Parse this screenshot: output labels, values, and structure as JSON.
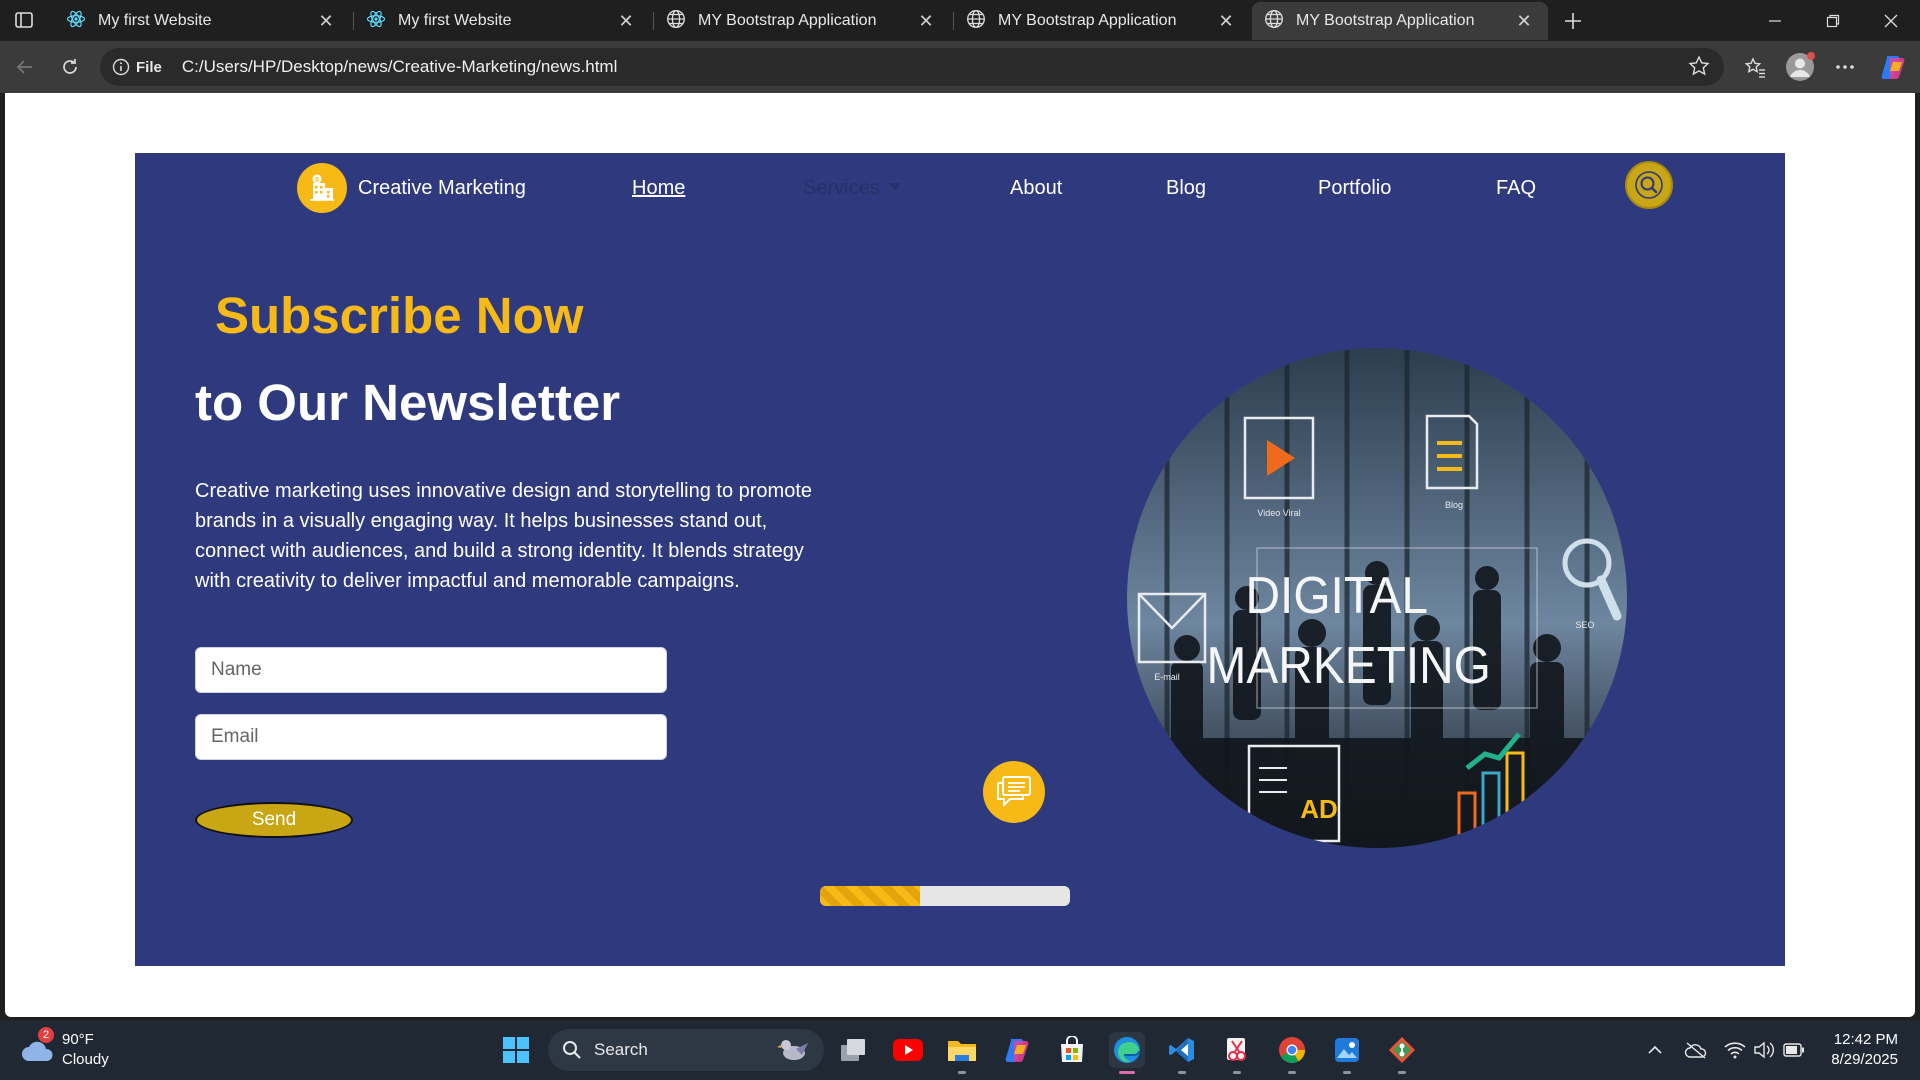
{
  "browser": {
    "tabs": [
      {
        "title": "My first Website",
        "icon": "react-icon",
        "active": false
      },
      {
        "title": "My first Website",
        "icon": "react-icon",
        "active": false
      },
      {
        "title": "MY Bootstrap Application",
        "icon": "globe-icon",
        "active": false
      },
      {
        "title": "MY Bootstrap Application",
        "icon": "globe-icon",
        "active": false
      },
      {
        "title": "MY Bootstrap Application",
        "icon": "globe-icon",
        "active": true
      }
    ],
    "address": {
      "scheme_label": "File",
      "url": "C:/Users/HP/Desktop/news/Creative-Marketing/news.html"
    }
  },
  "site": {
    "brand": {
      "name": "Creative Marketing",
      "logo_icon": "building-icon"
    },
    "nav": {
      "home": "Home",
      "services": "Services",
      "about": "About",
      "blog": "Blog",
      "portfolio": "Portfolio",
      "faq": "FAQ"
    },
    "hero": {
      "subtitle": "Subscribe Now",
      "title": "to Our Newsletter",
      "description": "Creative marketing uses innovative design and storytelling to promote brands in a visually engaging way. It helps businesses stand out, connect with audiences, and build a strong identity. It blends strategy with creativity to deliver impactful and memorable campaigns.",
      "name_placeholder": "Name",
      "email_placeholder": "Email",
      "send_label": "Send",
      "image_line1": "DIGITAL",
      "image_line2": "MARKETING",
      "image_tags": {
        "video": "Video Viral",
        "blog": "Blog",
        "email": "E-mail",
        "seo": "SEO",
        "ad": "AD"
      }
    },
    "progress": 0.4,
    "colors": {
      "primary": "#2f3a7e",
      "accent": "#f7b916",
      "button": "#c8a614"
    }
  },
  "taskbar": {
    "weather": {
      "temp": "90°F",
      "condition": "Cloudy",
      "badge": "2"
    },
    "search_placeholder": "Search",
    "clock": {
      "time": "12:42 PM",
      "date": "8/29/2025"
    }
  }
}
